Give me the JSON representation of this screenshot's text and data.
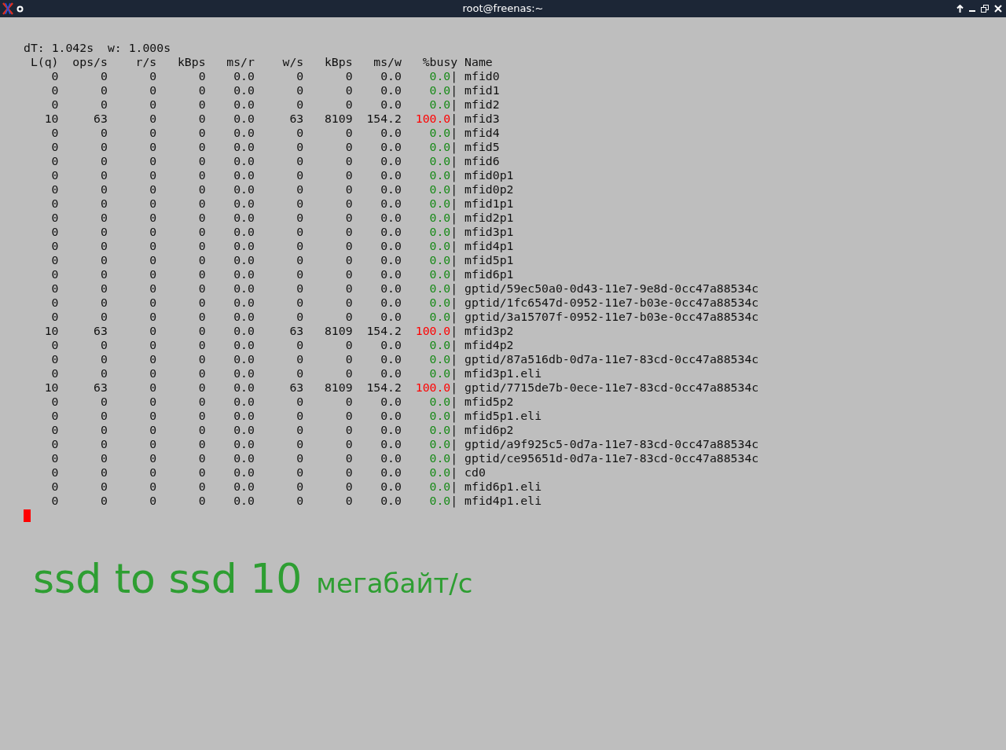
{
  "window": {
    "title": "root@freenas:~"
  },
  "terminal": {
    "summary": [
      "dT: 1.042s",
      "w: 1.000s"
    ],
    "columns": [
      "L(q)",
      "ops/s",
      "r/s",
      "kBps",
      "ms/r",
      "w/s",
      "kBps",
      "ms/w",
      "%busy",
      "Name"
    ],
    "rows": [
      {
        "values": [
          "0",
          "0",
          "0",
          "0",
          "0.0",
          "0",
          "0",
          "0.0"
        ],
        "busy": "0.0",
        "color": "#178a17",
        "name": "mfid0"
      },
      {
        "values": [
          "0",
          "0",
          "0",
          "0",
          "0.0",
          "0",
          "0",
          "0.0"
        ],
        "busy": "0.0",
        "color": "#178a17",
        "name": "mfid1"
      },
      {
        "values": [
          "0",
          "0",
          "0",
          "0",
          "0.0",
          "0",
          "0",
          "0.0"
        ],
        "busy": "0.0",
        "color": "#178a17",
        "name": "mfid2"
      },
      {
        "values": [
          "10",
          "63",
          "0",
          "0",
          "0.0",
          "63",
          "8109",
          "154.2"
        ],
        "busy": "100.0",
        "color": "#ff0000",
        "name": "mfid3"
      },
      {
        "values": [
          "0",
          "0",
          "0",
          "0",
          "0.0",
          "0",
          "0",
          "0.0"
        ],
        "busy": "0.0",
        "color": "#178a17",
        "name": "mfid4"
      },
      {
        "values": [
          "0",
          "0",
          "0",
          "0",
          "0.0",
          "0",
          "0",
          "0.0"
        ],
        "busy": "0.0",
        "color": "#178a17",
        "name": "mfid5"
      },
      {
        "values": [
          "0",
          "0",
          "0",
          "0",
          "0.0",
          "0",
          "0",
          "0.0"
        ],
        "busy": "0.0",
        "color": "#178a17",
        "name": "mfid6"
      },
      {
        "values": [
          "0",
          "0",
          "0",
          "0",
          "0.0",
          "0",
          "0",
          "0.0"
        ],
        "busy": "0.0",
        "color": "#178a17",
        "name": "mfid0p1"
      },
      {
        "values": [
          "0",
          "0",
          "0",
          "0",
          "0.0",
          "0",
          "0",
          "0.0"
        ],
        "busy": "0.0",
        "color": "#178a17",
        "name": "mfid0p2"
      },
      {
        "values": [
          "0",
          "0",
          "0",
          "0",
          "0.0",
          "0",
          "0",
          "0.0"
        ],
        "busy": "0.0",
        "color": "#178a17",
        "name": "mfid1p1"
      },
      {
        "values": [
          "0",
          "0",
          "0",
          "0",
          "0.0",
          "0",
          "0",
          "0.0"
        ],
        "busy": "0.0",
        "color": "#178a17",
        "name": "mfid2p1"
      },
      {
        "values": [
          "0",
          "0",
          "0",
          "0",
          "0.0",
          "0",
          "0",
          "0.0"
        ],
        "busy": "0.0",
        "color": "#178a17",
        "name": "mfid3p1"
      },
      {
        "values": [
          "0",
          "0",
          "0",
          "0",
          "0.0",
          "0",
          "0",
          "0.0"
        ],
        "busy": "0.0",
        "color": "#178a17",
        "name": "mfid4p1"
      },
      {
        "values": [
          "0",
          "0",
          "0",
          "0",
          "0.0",
          "0",
          "0",
          "0.0"
        ],
        "busy": "0.0",
        "color": "#178a17",
        "name": "mfid5p1"
      },
      {
        "values": [
          "0",
          "0",
          "0",
          "0",
          "0.0",
          "0",
          "0",
          "0.0"
        ],
        "busy": "0.0",
        "color": "#178a17",
        "name": "mfid6p1"
      },
      {
        "values": [
          "0",
          "0",
          "0",
          "0",
          "0.0",
          "0",
          "0",
          "0.0"
        ],
        "busy": "0.0",
        "color": "#178a17",
        "name": "gptid/59ec50a0-0d43-11e7-9e8d-0cc47a88534c"
      },
      {
        "values": [
          "0",
          "0",
          "0",
          "0",
          "0.0",
          "0",
          "0",
          "0.0"
        ],
        "busy": "0.0",
        "color": "#178a17",
        "name": "gptid/1fc6547d-0952-11e7-b03e-0cc47a88534c"
      },
      {
        "values": [
          "0",
          "0",
          "0",
          "0",
          "0.0",
          "0",
          "0",
          "0.0"
        ],
        "busy": "0.0",
        "color": "#178a17",
        "name": "gptid/3a15707f-0952-11e7-b03e-0cc47a88534c"
      },
      {
        "values": [
          "10",
          "63",
          "0",
          "0",
          "0.0",
          "63",
          "8109",
          "154.2"
        ],
        "busy": "100.0",
        "color": "#ff0000",
        "name": "mfid3p2"
      },
      {
        "values": [
          "0",
          "0",
          "0",
          "0",
          "0.0",
          "0",
          "0",
          "0.0"
        ],
        "busy": "0.0",
        "color": "#178a17",
        "name": "mfid4p2"
      },
      {
        "values": [
          "0",
          "0",
          "0",
          "0",
          "0.0",
          "0",
          "0",
          "0.0"
        ],
        "busy": "0.0",
        "color": "#178a17",
        "name": "gptid/87a516db-0d7a-11e7-83cd-0cc47a88534c"
      },
      {
        "values": [
          "0",
          "0",
          "0",
          "0",
          "0.0",
          "0",
          "0",
          "0.0"
        ],
        "busy": "0.0",
        "color": "#178a17",
        "name": "mfid3p1.eli"
      },
      {
        "values": [
          "10",
          "63",
          "0",
          "0",
          "0.0",
          "63",
          "8109",
          "154.2"
        ],
        "busy": "100.0",
        "color": "#ff0000",
        "name": "gptid/7715de7b-0ece-11e7-83cd-0cc47a88534c"
      },
      {
        "values": [
          "0",
          "0",
          "0",
          "0",
          "0.0",
          "0",
          "0",
          "0.0"
        ],
        "busy": "0.0",
        "color": "#178a17",
        "name": "mfid5p2"
      },
      {
        "values": [
          "0",
          "0",
          "0",
          "0",
          "0.0",
          "0",
          "0",
          "0.0"
        ],
        "busy": "0.0",
        "color": "#178a17",
        "name": "mfid5p1.eli"
      },
      {
        "values": [
          "0",
          "0",
          "0",
          "0",
          "0.0",
          "0",
          "0",
          "0.0"
        ],
        "busy": "0.0",
        "color": "#178a17",
        "name": "mfid6p2"
      },
      {
        "values": [
          "0",
          "0",
          "0",
          "0",
          "0.0",
          "0",
          "0",
          "0.0"
        ],
        "busy": "0.0",
        "color": "#178a17",
        "name": "gptid/a9f925c5-0d7a-11e7-83cd-0cc47a88534c"
      },
      {
        "values": [
          "0",
          "0",
          "0",
          "0",
          "0.0",
          "0",
          "0",
          "0.0"
        ],
        "busy": "0.0",
        "color": "#178a17",
        "name": "gptid/ce95651d-0d7a-11e7-83cd-0cc47a88534c"
      },
      {
        "values": [
          "0",
          "0",
          "0",
          "0",
          "0.0",
          "0",
          "0",
          "0.0"
        ],
        "busy": "0.0",
        "color": "#178a17",
        "name": "cd0"
      },
      {
        "values": [
          "0",
          "0",
          "0",
          "0",
          "0.0",
          "0",
          "0",
          "0.0"
        ],
        "busy": "0.0",
        "color": "#178a17",
        "name": "mfid6p1.eli"
      },
      {
        "values": [
          "0",
          "0",
          "0",
          "0",
          "0.0",
          "0",
          "0",
          "0.0"
        ],
        "busy": "0.0",
        "color": "#178a17",
        "name": "mfid4p1.eli"
      }
    ],
    "separator": "|"
  },
  "annotation": {
    "headline": "ssd to ssd 10",
    "unit": "мегабайт/с"
  }
}
